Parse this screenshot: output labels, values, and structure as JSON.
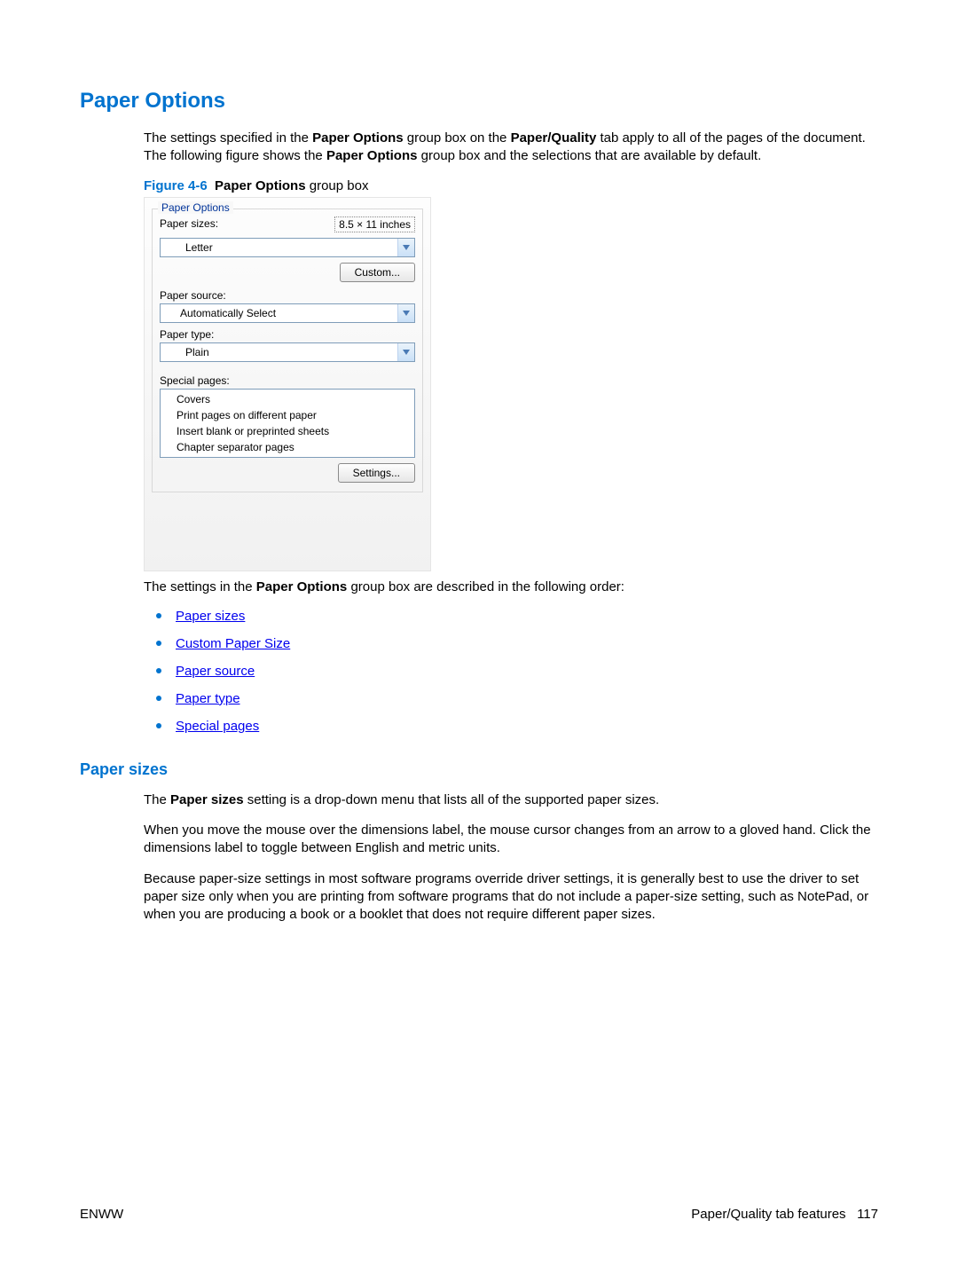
{
  "heading": "Paper Options",
  "intro": {
    "pre1": "The settings specified in the ",
    "b1": "Paper Options",
    "mid1": " group box on the ",
    "b2": "Paper/Quality",
    "mid2": " tab apply to all of the pages of the document. The following figure shows the ",
    "b3": "Paper Options",
    "post": " group box and the selections that are available by default."
  },
  "figure": {
    "num": "Figure 4-6",
    "title_bold": "Paper Options",
    "title_rest": " group box"
  },
  "groupbox": {
    "legend": "Paper Options",
    "paper_sizes_label": "Paper sizes:",
    "dimensions": "8.5 × 11 inches",
    "paper_sizes_value": "Letter",
    "custom_btn": "Custom...",
    "paper_source_label": "Paper source:",
    "paper_source_value": "Automatically Select",
    "paper_type_label": "Paper type:",
    "paper_type_value": "Plain",
    "special_label": "Special pages:",
    "special_items": [
      "Covers",
      "Print pages on different paper",
      "Insert blank or preprinted sheets",
      "Chapter separator pages"
    ],
    "settings_btn": "Settings..."
  },
  "after_fig": {
    "pre": "The settings in the ",
    "b": "Paper Options",
    "post": " group box are described in the following order:"
  },
  "links": [
    "Paper sizes",
    "Custom Paper Size",
    "Paper source",
    "Paper type",
    "Special pages"
  ],
  "subheading": "Paper sizes",
  "p1": {
    "pre": "The ",
    "b": "Paper sizes",
    "post": " setting is a drop-down menu that lists all of the supported paper sizes."
  },
  "p2": "When you move the mouse over the dimensions label, the mouse cursor changes from an arrow to a gloved hand. Click the dimensions label to toggle between English and metric units.",
  "p3": "Because paper-size settings in most software programs override driver settings, it is generally best to use the driver to set paper size only when you are printing from software programs that do not include a paper-size setting, such as NotePad, or when you are producing a book or a booklet that does not require different paper sizes.",
  "footer": {
    "left": "ENWW",
    "right_label": "Paper/Quality tab features",
    "right_page": "117"
  }
}
